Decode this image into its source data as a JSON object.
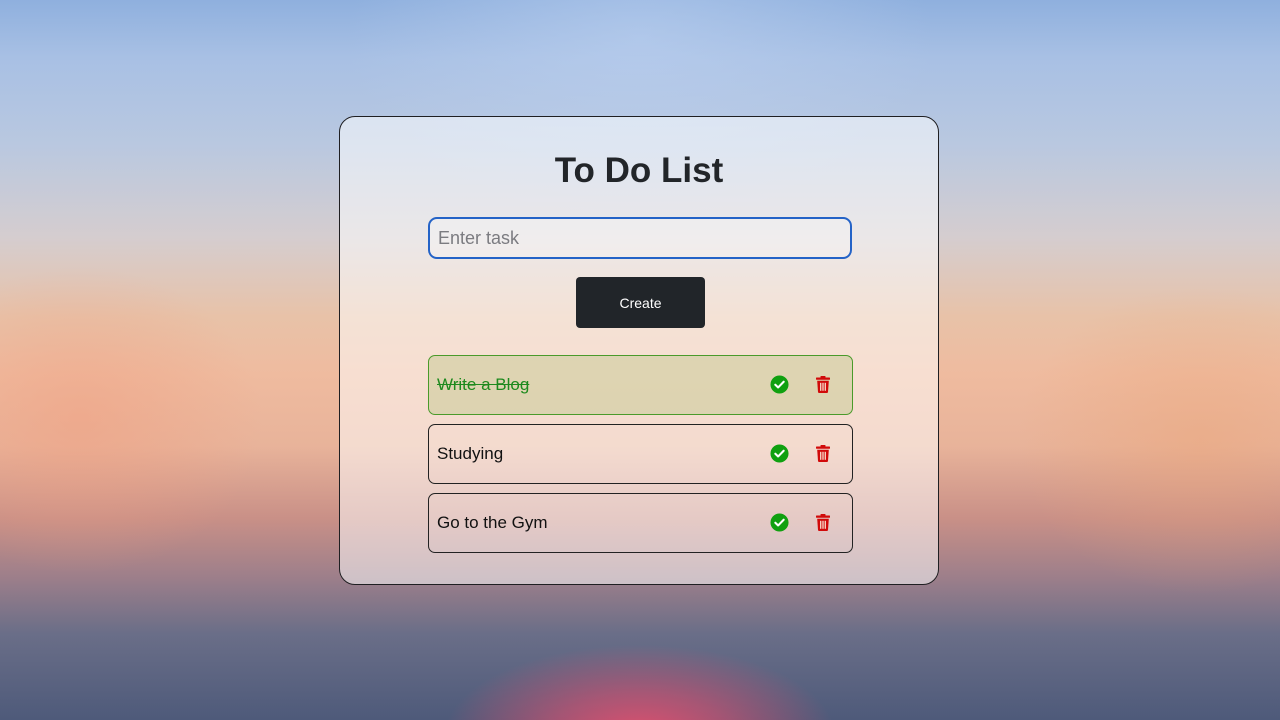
{
  "app": {
    "title": "To Do List"
  },
  "input": {
    "value": "",
    "placeholder": "Enter task"
  },
  "create_button": {
    "label": "Create"
  },
  "tasks": [
    {
      "text": "Write a Blog",
      "completed": true,
      "complete_icon": "check-circle-icon",
      "delete_icon": "trash-icon"
    },
    {
      "text": "Studying",
      "completed": false,
      "complete_icon": "check-circle-icon",
      "delete_icon": "trash-icon"
    },
    {
      "text": "Go to the Gym",
      "completed": false,
      "complete_icon": "check-circle-icon",
      "delete_icon": "trash-icon"
    }
  ],
  "colors": {
    "accent_input_border": "#2463c7",
    "button_bg": "#212529",
    "check_green": "#10a010",
    "delete_red": "#d10a0a",
    "completed_text": "#1e8a1e"
  }
}
